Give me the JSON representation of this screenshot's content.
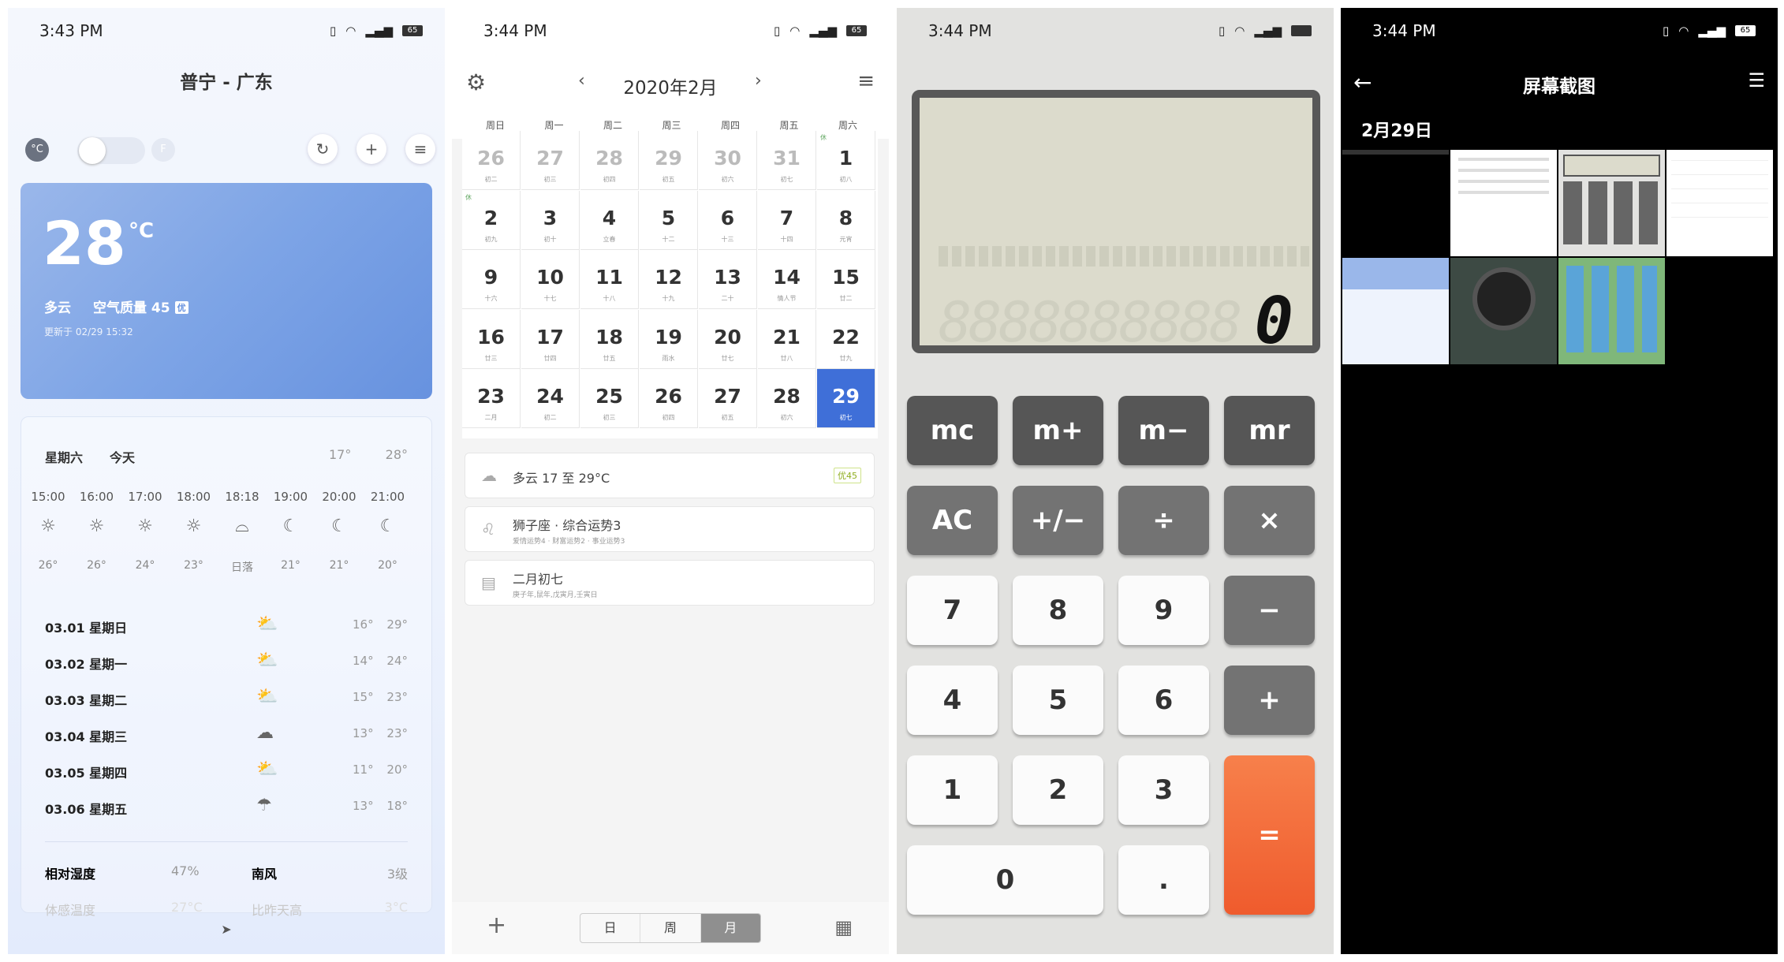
{
  "status_bars": [
    {
      "time": "3:43 PM",
      "battery": "65"
    },
    {
      "time": "3:44 PM",
      "battery": "65"
    },
    {
      "time": "3:44 PM",
      "battery": ""
    },
    {
      "time": "3:44 PM",
      "battery": "65"
    }
  ],
  "weather": {
    "location": "普宁 - 广东",
    "unit_c": "°C",
    "unit_f": "F",
    "temp": "28",
    "temp_unit": "°C",
    "condition": "多云",
    "air_quality": "空气质量 45",
    "aq_badge": "优",
    "updated": "更新于 02/29 15:32",
    "day_label": "星期六",
    "today": "今天",
    "low": "17°",
    "high": "28°",
    "hourly": [
      {
        "time": "15:00",
        "icon": "sun-icon",
        "temp": "26°"
      },
      {
        "time": "16:00",
        "icon": "sun-icon",
        "temp": "26°"
      },
      {
        "time": "17:00",
        "icon": "sun-icon",
        "temp": "24°"
      },
      {
        "time": "18:00",
        "icon": "sun-icon",
        "temp": "23°"
      },
      {
        "time": "18:18",
        "icon": "sunset-icon",
        "temp": "日落"
      },
      {
        "time": "19:00",
        "icon": "moon-icon",
        "temp": "21°"
      },
      {
        "time": "20:00",
        "icon": "moon-icon",
        "temp": "21°"
      },
      {
        "time": "21:00",
        "icon": "moon-icon",
        "temp": "20°"
      }
    ],
    "daily": [
      {
        "date": "03.01 星期日",
        "icon": "partly-cloudy-icon",
        "low": "16°",
        "high": "29°"
      },
      {
        "date": "03.02 星期一",
        "icon": "partly-cloudy-icon",
        "low": "14°",
        "high": "24°"
      },
      {
        "date": "03.03 星期二",
        "icon": "partly-cloudy-icon",
        "low": "15°",
        "high": "23°"
      },
      {
        "date": "03.04 星期三",
        "icon": "cloud-icon",
        "low": "13°",
        "high": "23°"
      },
      {
        "date": "03.05 星期四",
        "icon": "partly-cloudy-icon",
        "low": "11°",
        "high": "20°"
      },
      {
        "date": "03.06 星期五",
        "icon": "cloud-rain-icon",
        "low": "13°",
        "high": "18°"
      }
    ],
    "humidity_label": "相对湿度",
    "humidity": "47%",
    "wind_label": "南风",
    "wind": "3级",
    "feels_label": "体感温度",
    "feels": "27°C",
    "compare_label": "比昨天高",
    "compare": "3°C"
  },
  "calendar": {
    "title": "2020年2月",
    "weekdays": [
      "周日",
      "周一",
      "周二",
      "周三",
      "周四",
      "周五",
      "周六"
    ],
    "days": [
      {
        "n": "26",
        "l": "初二",
        "g": true
      },
      {
        "n": "27",
        "l": "初三",
        "g": true
      },
      {
        "n": "28",
        "l": "初四",
        "g": true
      },
      {
        "n": "29",
        "l": "初五",
        "g": true
      },
      {
        "n": "30",
        "l": "初六",
        "g": true
      },
      {
        "n": "31",
        "l": "初七",
        "g": true
      },
      {
        "n": "1",
        "l": "初八",
        "h": "休"
      },
      {
        "n": "2",
        "l": "初九",
        "h": "休"
      },
      {
        "n": "3",
        "l": "初十"
      },
      {
        "n": "4",
        "l": "立春"
      },
      {
        "n": "5",
        "l": "十二"
      },
      {
        "n": "6",
        "l": "十三"
      },
      {
        "n": "7",
        "l": "十四"
      },
      {
        "n": "8",
        "l": "元宵"
      },
      {
        "n": "9",
        "l": "十六"
      },
      {
        "n": "10",
        "l": "十七"
      },
      {
        "n": "11",
        "l": "十八"
      },
      {
        "n": "12",
        "l": "十九"
      },
      {
        "n": "13",
        "l": "二十"
      },
      {
        "n": "14",
        "l": "情人节"
      },
      {
        "n": "15",
        "l": "廿二"
      },
      {
        "n": "16",
        "l": "廿三"
      },
      {
        "n": "17",
        "l": "廿四"
      },
      {
        "n": "18",
        "l": "廿五"
      },
      {
        "n": "19",
        "l": "雨水"
      },
      {
        "n": "20",
        "l": "廿七"
      },
      {
        "n": "21",
        "l": "廿八"
      },
      {
        "n": "22",
        "l": "廿九"
      },
      {
        "n": "23",
        "l": "二月"
      },
      {
        "n": "24",
        "l": "初二"
      },
      {
        "n": "25",
        "l": "初三"
      },
      {
        "n": "26",
        "l": "初四"
      },
      {
        "n": "27",
        "l": "初五"
      },
      {
        "n": "28",
        "l": "初六"
      },
      {
        "n": "29",
        "l": "初七",
        "sel": true
      }
    ],
    "weather_text": "多云  17 至 29°C",
    "weather_tag": "优45",
    "horoscope": "狮子座 · 综合运势3",
    "horoscope_sub": "爱情运势4 · 财富运势2 · 事业运势3",
    "lunar": "二月初七",
    "lunar_sub": "庚子年,鼠年,戊寅月,壬寅日",
    "views": [
      "日",
      "周",
      "月"
    ]
  },
  "calculator": {
    "ghost": "8888888888",
    "display": "0",
    "keys": [
      "mc",
      "m+",
      "m−",
      "mr",
      "AC",
      "+∕−",
      "÷",
      "×",
      "7",
      "8",
      "9",
      "−",
      "4",
      "5",
      "6",
      "+",
      "1",
      "2",
      "3",
      "=",
      "0",
      "."
    ]
  },
  "gallery": {
    "title": "屏幕截图",
    "date": "2月29日"
  }
}
